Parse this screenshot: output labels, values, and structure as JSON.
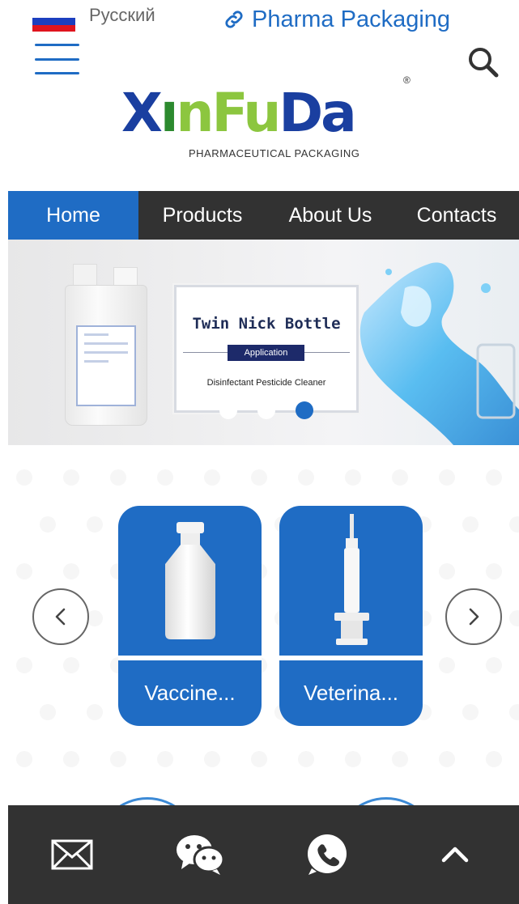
{
  "header": {
    "language": {
      "label": "Русский",
      "flag_colors": [
        "#ffffff",
        "#1c3fbf",
        "#e0141e"
      ]
    },
    "pharma_link": {
      "label": "Pharma Packaging",
      "icon": "link-icon"
    },
    "menu_icon": "hamburger-menu-icon",
    "search_icon": "search-icon"
  },
  "logo": {
    "word_parts": [
      "X",
      "ı",
      "nF",
      "u",
      "Da"
    ],
    "registered": "®",
    "subtitle": "PHARMACEUTICAL PACKAGING"
  },
  "nav": {
    "items": [
      {
        "label": "Home",
        "active": true
      },
      {
        "label": "Products",
        "active": false
      },
      {
        "label": "About Us",
        "active": false
      },
      {
        "label": "Contacts",
        "active": false
      }
    ]
  },
  "banner": {
    "title": "Twin Nick Bottle",
    "tag": "Application",
    "description": "Disinfectant  Pesticide  Cleaner",
    "slide_count": 3,
    "active_slide": 3
  },
  "products": {
    "prev_icon": "chevron-left-icon",
    "next_icon": "chevron-right-icon",
    "items": [
      {
        "name": "Vaccine...",
        "image": "vaccine-bottle-image"
      },
      {
        "name": "Veterina...",
        "image": "veterinary-syringe-image"
      }
    ]
  },
  "bottom_bar": {
    "items": [
      {
        "icon": "mail-icon"
      },
      {
        "icon": "wechat-icon"
      },
      {
        "icon": "whatsapp-icon"
      },
      {
        "icon": "back-to-top-icon"
      }
    ]
  },
  "colors": {
    "primary": "#1f6cc4",
    "dark_bar": "#323232",
    "logo_blue": "#1a3fa0",
    "logo_green": "#8cc63f"
  }
}
